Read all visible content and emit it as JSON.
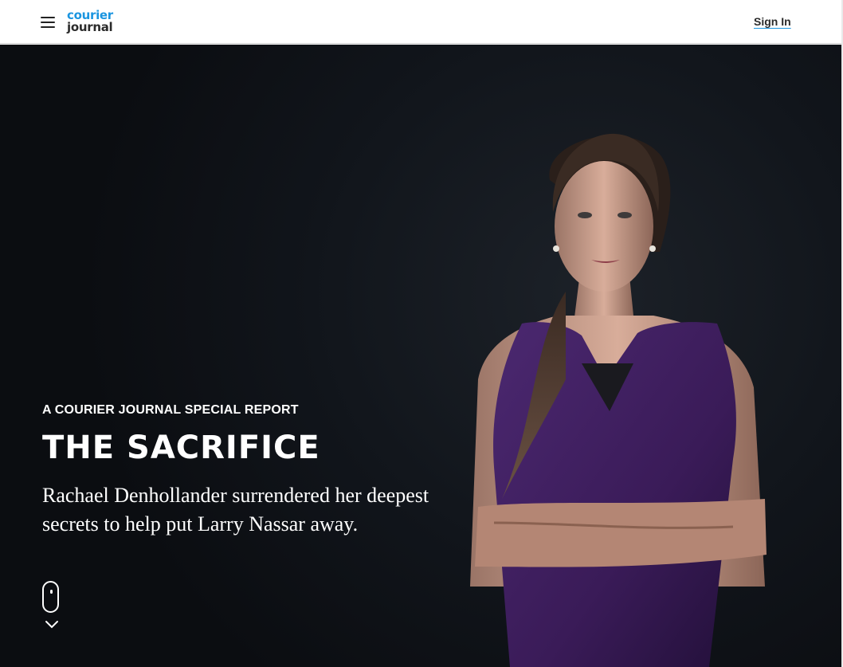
{
  "header": {
    "logo": {
      "line1": "courier",
      "line2": "journal"
    },
    "sign_in_label": "Sign In"
  },
  "hero": {
    "kicker": "A COURIER JOURNAL SPECIAL REPORT",
    "headline": "THE SACRIFICE",
    "dek": "Rachael Denhollander surrendered her deepest secrets to help put Larry Nassar away."
  },
  "colors": {
    "brand_blue": "#1b95e0",
    "hero_background": "#11151b",
    "dress_purple": "#3f1f5e"
  },
  "icons": {
    "menu": "hamburger-menu-icon",
    "scroll": "scroll-mouse-icon",
    "chevron": "chevron-down-icon"
  }
}
